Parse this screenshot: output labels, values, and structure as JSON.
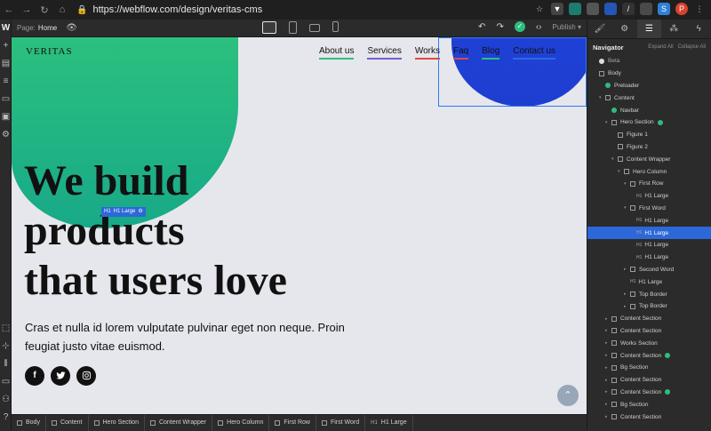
{
  "browser": {
    "url": "https://webflow.com/design/veritas-cms"
  },
  "designer": {
    "page_label": "Page:",
    "page_value": "Home",
    "publish_label": "Publish"
  },
  "site": {
    "logo": "VERITAS",
    "nav": [
      {
        "label": "About us",
        "color": "#2bc07e"
      },
      {
        "label": "Services",
        "color": "#7b5ad6"
      },
      {
        "label": "Works",
        "color": "#e04848"
      },
      {
        "label": "Faq",
        "color": "#e04848"
      },
      {
        "label": "Blog",
        "color": "#2bc07e"
      },
      {
        "label": "Contact us",
        "color": "#2d6be0"
      }
    ],
    "hero_title_lines": [
      "We build",
      "products",
      "that users love"
    ],
    "hero_subtitle": "Cras et nulla id lorem vulputate pulvinar eget non neque. Proin feugiat justo vitae euismod.",
    "selected_badge": "H1 Large",
    "socials": [
      {
        "icon": "facebook-icon",
        "glyph": "f"
      },
      {
        "icon": "twitter-icon",
        "glyph": "🐦"
      },
      {
        "icon": "instagram-icon",
        "glyph": "◎"
      }
    ]
  },
  "navigator": {
    "title": "Navigator",
    "expand_all": "Expand All",
    "collapse_all": "Collapse All",
    "rows": [
      {
        "label": "Beta",
        "indent": 0,
        "kind": "beta"
      },
      {
        "label": "Body",
        "indent": 0,
        "kind": "box"
      },
      {
        "label": "Preloader",
        "indent": 1,
        "kind": "dot"
      },
      {
        "label": "Content",
        "indent": 1,
        "kind": "box",
        "arrow": "▾"
      },
      {
        "label": "Navbar",
        "indent": 2,
        "kind": "dot"
      },
      {
        "label": "Hero Section",
        "indent": 2,
        "kind": "box",
        "arrow": "▾",
        "plus": true
      },
      {
        "label": "Figure 1",
        "indent": 3,
        "kind": "box"
      },
      {
        "label": "Figure 2",
        "indent": 3,
        "kind": "box"
      },
      {
        "label": "Content Wrapper",
        "indent": 3,
        "kind": "box",
        "arrow": "▾"
      },
      {
        "label": "Hero Column",
        "indent": 4,
        "kind": "box",
        "arrow": "▾"
      },
      {
        "label": "First Row",
        "indent": 5,
        "kind": "box",
        "arrow": "▾"
      },
      {
        "label": "H1 Large",
        "indent": 6,
        "kind": "h1"
      },
      {
        "label": "First Word",
        "indent": 5,
        "kind": "box",
        "arrow": "▾"
      },
      {
        "label": "H1 Large",
        "indent": 6,
        "kind": "h1"
      },
      {
        "label": "H1 Large",
        "indent": 6,
        "kind": "h1",
        "selected": true
      },
      {
        "label": "H1 Large",
        "indent": 6,
        "kind": "h1"
      },
      {
        "label": "H1 Large",
        "indent": 6,
        "kind": "h1"
      },
      {
        "label": "Second Word",
        "indent": 5,
        "kind": "box",
        "arrow": "▸"
      },
      {
        "label": "H1 Large",
        "indent": 5,
        "kind": "h1"
      },
      {
        "label": "Top Border",
        "indent": 5,
        "kind": "box",
        "arrow": "▸"
      },
      {
        "label": "Top Border",
        "indent": 5,
        "kind": "box",
        "arrow": "▸"
      },
      {
        "label": "Content Section",
        "indent": 2,
        "kind": "box",
        "arrow": "▸"
      },
      {
        "label": "Content Section",
        "indent": 2,
        "kind": "box",
        "arrow": "▸"
      },
      {
        "label": "Works Section",
        "indent": 2,
        "kind": "box",
        "arrow": "▸"
      },
      {
        "label": "Content Section",
        "indent": 2,
        "kind": "box",
        "arrow": "▸",
        "plus": true
      },
      {
        "label": "Bg Section",
        "indent": 2,
        "kind": "box",
        "arrow": "▸"
      },
      {
        "label": "Content Section",
        "indent": 2,
        "kind": "box",
        "arrow": "▸"
      },
      {
        "label": "Content Section",
        "indent": 2,
        "kind": "box",
        "arrow": "▸",
        "plus": true
      },
      {
        "label": "Bg Section",
        "indent": 2,
        "kind": "box",
        "arrow": "▸"
      },
      {
        "label": "Content Section",
        "indent": 2,
        "kind": "box",
        "arrow": "▸"
      }
    ]
  },
  "breadcrumb": [
    "Body",
    "Content",
    "Hero Section",
    "Content Wrapper",
    "Hero Column",
    "First Row",
    "First Word",
    "H1 Large"
  ]
}
